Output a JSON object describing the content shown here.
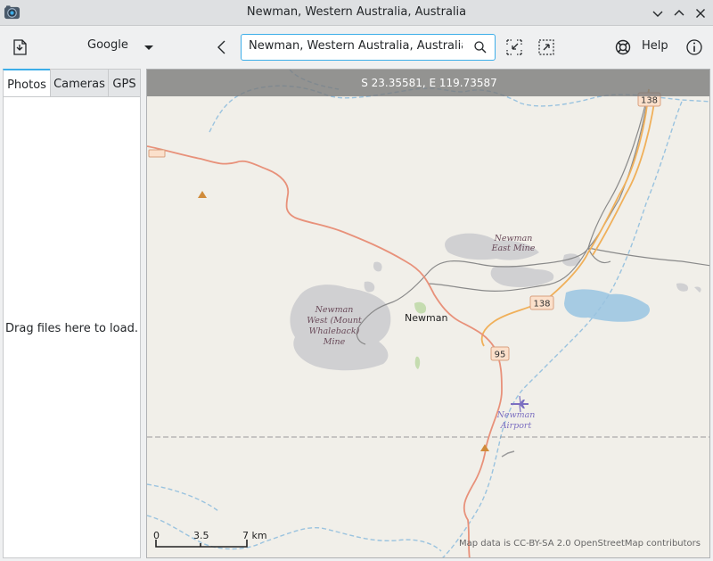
{
  "window": {
    "title": "Newman, Western Australia, Australia"
  },
  "toolbar": {
    "provider": "Google",
    "search_value": "Newman, Western Australia, Australia",
    "help_label": "Help"
  },
  "sidebar": {
    "tabs": [
      {
        "label": "Photos"
      },
      {
        "label": "Cameras"
      },
      {
        "label": "GPS"
      }
    ],
    "drop_hint": "Drag files here to load."
  },
  "map": {
    "coordinates": "S 23.35581, E 119.73587",
    "labels": {
      "town": "Newman",
      "east_mine": [
        "Newman",
        "East Mine"
      ],
      "west_mine": [
        "Newman",
        "West (Mount",
        "Whaleback)",
        "Mine"
      ],
      "airport": [
        "Newman",
        "Airport"
      ]
    },
    "shields": {
      "road_138": "138",
      "road_95": "95"
    },
    "scale": {
      "zero": "0",
      "mid": "3.5",
      "end": "7 km"
    },
    "attribution": "Map data is CC-BY-SA 2.0 OpenStreetMap contributors",
    "colors": {
      "main_road": "#e8917a",
      "secondary_road": "#f0b05a",
      "water": "#a6cbe3",
      "mine": "#d0d0d2",
      "rail": "#8a8a8a",
      "airport": "#7c6fc1"
    }
  }
}
